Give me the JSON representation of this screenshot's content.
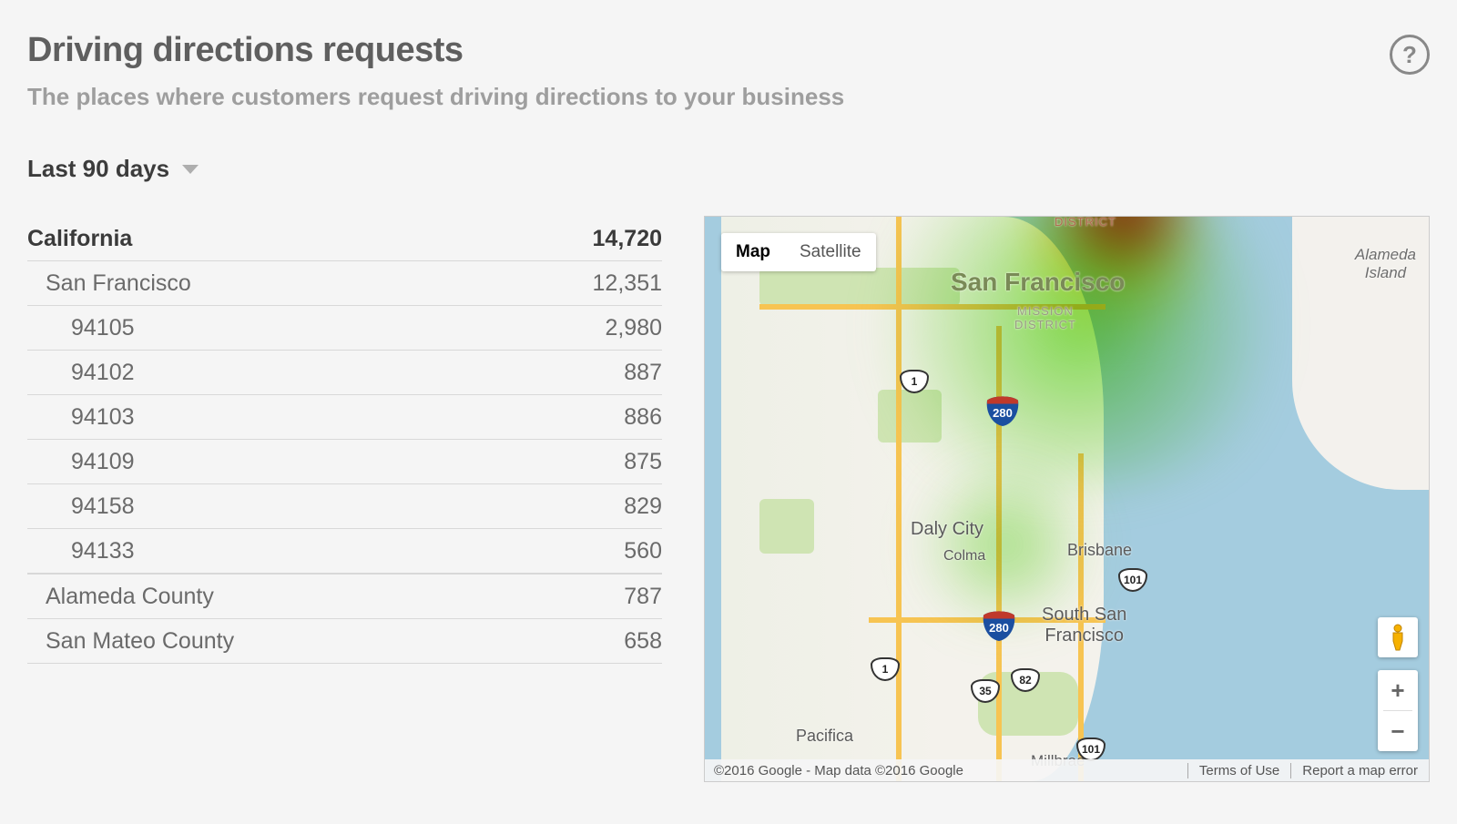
{
  "header": {
    "title": "Driving directions requests",
    "subtitle": "The places where customers request driving directions to your business",
    "help_tooltip": "?"
  },
  "date_range": {
    "selected": "Last 90 days"
  },
  "region": {
    "name": "California",
    "total": "14,720",
    "areas": [
      {
        "name": "San Francisco",
        "total": "12,351",
        "zips": [
          {
            "code": "94105",
            "count": "2,980"
          },
          {
            "code": "94102",
            "count": "887"
          },
          {
            "code": "94103",
            "count": "886"
          },
          {
            "code": "94109",
            "count": "875"
          },
          {
            "code": "94158",
            "count": "829"
          },
          {
            "code": "94133",
            "count": "560"
          }
        ]
      },
      {
        "name": "Alameda County",
        "total": "787"
      },
      {
        "name": "San Mateo County",
        "total": "658"
      }
    ]
  },
  "map": {
    "types": {
      "map": "Map",
      "satellite": "Satellite"
    },
    "labels": {
      "sf": "San Francisco",
      "mission": "MISSION\nDISTRICT",
      "district_top": "DISTRICT",
      "alameda": "Alameda\nIsland",
      "daly": "Daly City",
      "colma": "Colma",
      "brisbane": "Brisbane",
      "ssf": "South San\nFrancisco",
      "pacifica": "Pacifica",
      "millbrae": "Millbrae"
    },
    "roads": {
      "r1": "1",
      "r101": "101",
      "r82": "82",
      "r35": "35",
      "i280": "280"
    },
    "footer": {
      "attribution": "©2016 Google - Map data ©2016 Google",
      "terms": "Terms of Use",
      "report": "Report a map error"
    },
    "controls": {
      "zoom_in": "+",
      "zoom_out": "−"
    }
  }
}
